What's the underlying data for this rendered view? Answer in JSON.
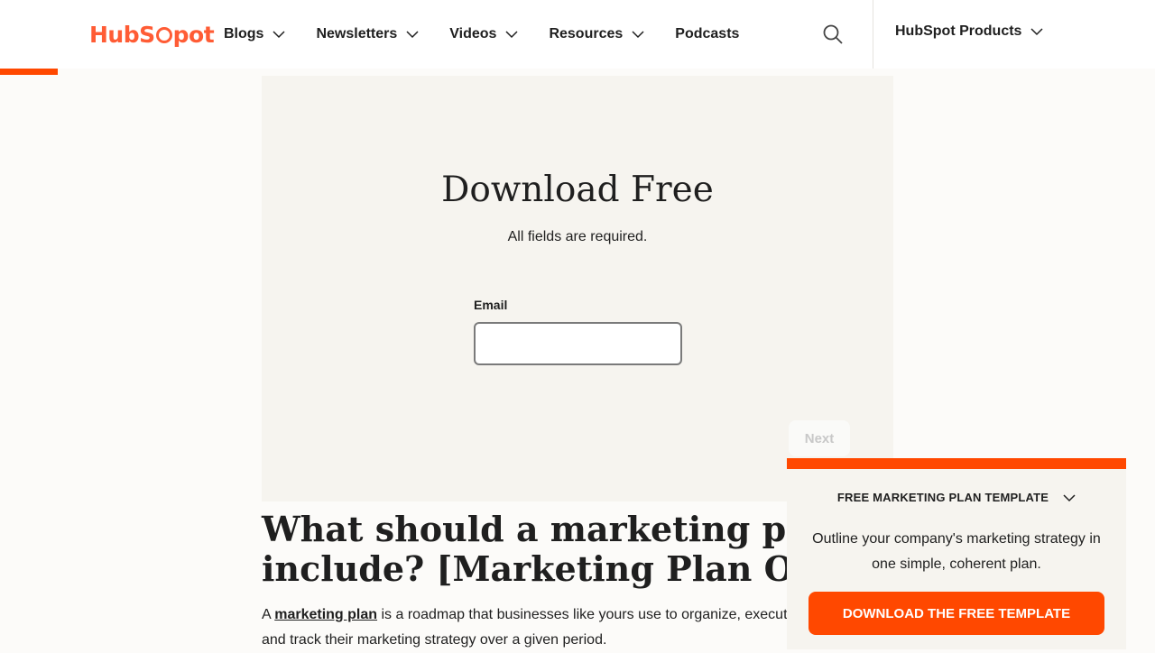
{
  "header": {
    "logo_text_pre": "Hub",
    "logo_text_post": "pot",
    "nav": [
      {
        "label": "Blogs"
      },
      {
        "label": "Newsletters"
      },
      {
        "label": "Videos"
      },
      {
        "label": "Resources"
      },
      {
        "label": "Podcasts"
      }
    ],
    "products_label": "HubSpot Products"
  },
  "form": {
    "title": "Download Free",
    "subtitle": "All fields are required.",
    "email_label": "Email",
    "email_value": "",
    "next_label": "Next"
  },
  "article": {
    "title_line1": "What should a marketing plan",
    "title_line2": "include? [Marketing Plan Outline]",
    "body_pre": "A ",
    "body_link": "marketing plan",
    "body_post": " is a roadmap that businesses like yours use to organize, execute, and track their marketing strategy over a given period."
  },
  "cta": {
    "heading": "FREE MARKETING PLAN TEMPLATE",
    "text": "Outline your company's marketing strategy in one simple, coherent plan.",
    "button": "DOWNLOAD THE FREE TEMPLATE"
  },
  "colors": {
    "brand_orange": "#ff4800",
    "panel_bg": "#f6f4ef"
  }
}
